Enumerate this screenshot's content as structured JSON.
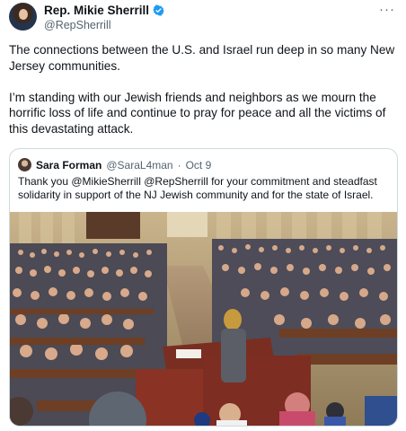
{
  "author": {
    "display_name": "Rep. Mikie Sherrill",
    "handle": "@RepSherrill",
    "verified_icon": "verified-badge-icon",
    "avatar_icon": "profile-photo-icon"
  },
  "more_icon": "more-options-icon",
  "more_glyph": "···",
  "body": {
    "paragraph_1": "The connections between the U.S. and Israel run deep in so many New Jersey communities.",
    "paragraph_2": "I’m standing with our Jewish friends and neighbors as we mourn the horrific loss of life and continue to pray for peace and all the victims of this devastating attack."
  },
  "quoted_tweet": {
    "display_name": "Sara Forman",
    "handle": "@SaraL4man",
    "separator": "·",
    "date": "Oct 9",
    "text": "Thank you @MikieSherrill @RepSherrill for your commitment and steadfast solidarity in support of the NJ Jewish community and for the state of Israel.",
    "media_icon": "photo-synagogue-gathering"
  },
  "colors": {
    "verified": "#1d9bf0",
    "text": "#0f1419",
    "secondary_text": "#536471",
    "border": "#cfd9de"
  }
}
